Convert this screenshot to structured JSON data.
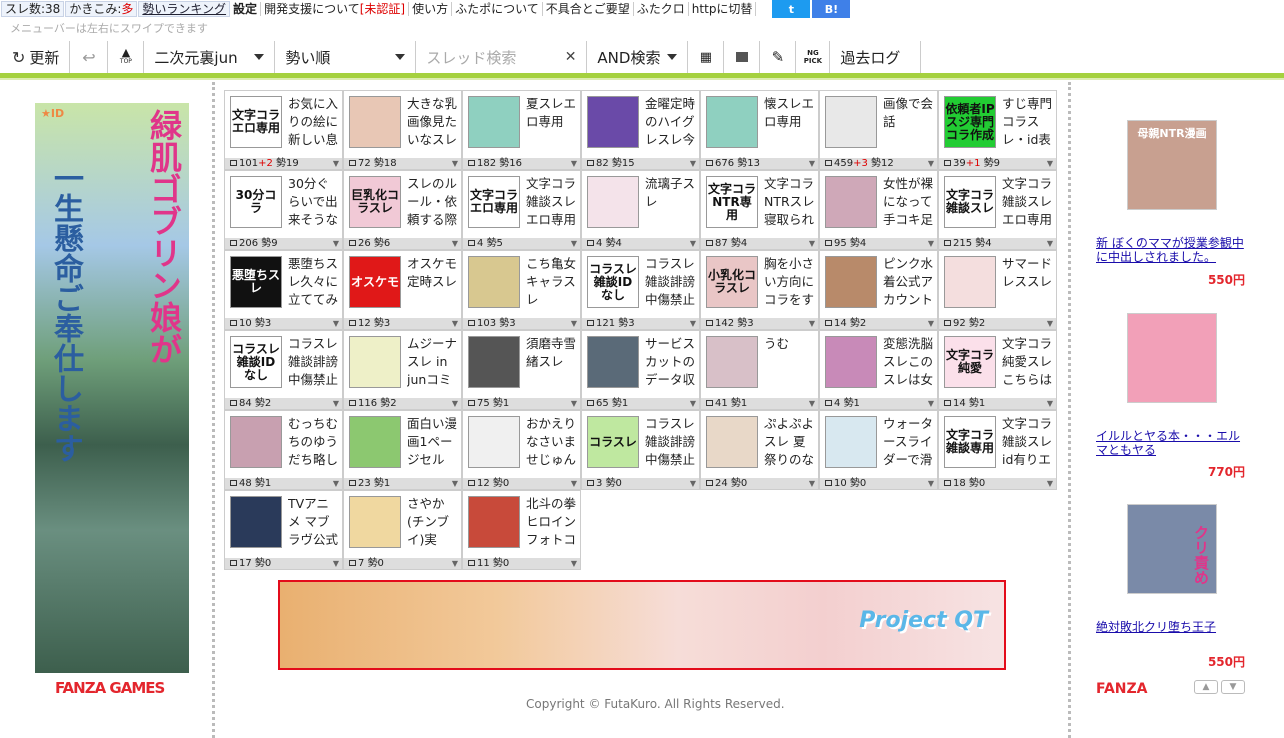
{
  "topmenu": {
    "thread_count": "スレ数:38",
    "posts_label": "かきこみ:",
    "posts_value": "多",
    "ranking": "勢いランキング",
    "settings": "設定",
    "devsupport": "開発支援について",
    "unverified": "[未認証]",
    "howto": "使い方",
    "about": "ふたポについて",
    "bugs": "不具合とご要望",
    "futakuro": "ふたクロ",
    "http": "httpに切替",
    "twitter": "t",
    "hatena": "B!"
  },
  "hint": "メニューバーは左右にスワイプできます",
  "toolbar": {
    "refresh": "更新",
    "top": "TOP",
    "board": "二次元裏jun",
    "sort": "勢い順",
    "search_placeholder": "スレッド検索",
    "search_mode": "AND検索",
    "ng": "NG PICK",
    "past_log": "過去ログ"
  },
  "colors": {
    "accent_green": "#a5d13e",
    "red": "#e3262d"
  },
  "left_ad": {
    "brand": "FANZA GAMES",
    "text1": "緑肌ゴブリン娘が",
    "text2": "一生懸命ご奉仕します"
  },
  "threads": [
    {
      "title": "お気に入りの絵に新しい息",
      "count": "101",
      "plus": "+2",
      "ikioi": "勢19",
      "thumb": "文字コラエロ専用",
      "bg": "#ffffff"
    },
    {
      "title": "大きな乳画像見たいなスレ",
      "count": "72",
      "plus": "",
      "ikioi": "勢18",
      "thumb": "",
      "bg": "#e8c7b5"
    },
    {
      "title": "夏スレエロ専用",
      "count": "182",
      "plus": "",
      "ikioi": "勢16",
      "thumb": "",
      "bg": "#8fd0c0"
    },
    {
      "title": "金曜定時のハイグレスレ今",
      "count": "82",
      "plus": "",
      "ikioi": "勢15",
      "thumb": "",
      "bg": "#6a4aa8"
    },
    {
      "title": "懐スレエロ専用",
      "count": "676",
      "plus": "",
      "ikioi": "勢13",
      "thumb": "",
      "bg": "#8fd0c0"
    },
    {
      "title": "画像で会話",
      "count": "459",
      "plus": "+3",
      "ikioi": "勢12",
      "thumb": "",
      "bg": "#e8e8e8"
    },
    {
      "title": "すじ専門コラスレ・id表",
      "count": "39",
      "plus": "+1",
      "ikioi": "勢9",
      "thumb": "依頼者IPスジ専門コラ作成",
      "bg": "#22cc33"
    },
    {
      "title": "30分ぐらいで出来そうなコ",
      "count": "206",
      "plus": "",
      "ikioi": "勢9",
      "thumb": "30分コラ",
      "bg": "#ffffff"
    },
    {
      "title": "スレのルール・依頼する際",
      "count": "26",
      "plus": "",
      "ikioi": "勢6",
      "thumb": "巨乳化コラスレ",
      "bg": "#f1c9d6"
    },
    {
      "title": "文字コラ雑談スレエロ専用",
      "count": "4",
      "plus": "",
      "ikioi": "勢5",
      "thumb": "文字コラエロ専用",
      "bg": "#ffffff"
    },
    {
      "title": "流璃子スレ",
      "count": "4",
      "plus": "",
      "ikioi": "勢4",
      "thumb": "",
      "bg": "#f4e3ea"
    },
    {
      "title": "文字コラNTRスレ寝取られ",
      "count": "87",
      "plus": "",
      "ikioi": "勢4",
      "thumb": "文字コラNTR専用",
      "bg": "#ffffff"
    },
    {
      "title": "女性が裸になって手コキ足",
      "count": "95",
      "plus": "",
      "ikioi": "勢4",
      "thumb": "",
      "bg": "#cfa8b8"
    },
    {
      "title": "文字コラ雑談スレエロ専用",
      "count": "215",
      "plus": "",
      "ikioi": "勢4",
      "thumb": "文字コラ雑談スレ",
      "bg": "#ffffff"
    },
    {
      "title": "悪堕ちスレ久々に立ててみ",
      "count": "10",
      "plus": "",
      "ikioi": "勢3",
      "thumb": "悪堕ちスレ",
      "bg": "#111111"
    },
    {
      "title": "オスケモ定時スレ",
      "count": "12",
      "plus": "",
      "ikioi": "勢3",
      "thumb": "オスケモ",
      "bg": "#e01818"
    },
    {
      "title": "こち亀女キャラスレ",
      "count": "103",
      "plus": "",
      "ikioi": "勢3",
      "thumb": "",
      "bg": "#d8c890"
    },
    {
      "title": "コラスレ雑談誹謗中傷禁止",
      "count": "121",
      "plus": "",
      "ikioi": "勢3",
      "thumb": "コラスレ雑談IDなし",
      "bg": "#ffffff"
    },
    {
      "title": "胸を小さい方向にコラをす",
      "count": "142",
      "plus": "",
      "ikioi": "勢3",
      "thumb": "小乳化コラスレ",
      "bg": "#e9c6c6"
    },
    {
      "title": "ピンク水着公式アカウント",
      "count": "14",
      "plus": "",
      "ikioi": "勢2",
      "thumb": "",
      "bg": "#b88a6a"
    },
    {
      "title": "サマードレススレ",
      "count": "92",
      "plus": "",
      "ikioi": "勢2",
      "thumb": "",
      "bg": "#f4dede"
    },
    {
      "title": "コラスレ雑談誹謗中傷禁止",
      "count": "84",
      "plus": "",
      "ikioi": "勢2",
      "thumb": "コラスレ雑談IDなし",
      "bg": "#ffffff"
    },
    {
      "title": "ムジーナスレ in junコミ",
      "count": "116",
      "plus": "",
      "ikioi": "勢2",
      "thumb": "",
      "bg": "#eef0c8"
    },
    {
      "title": "須磨寺雪緒スレ",
      "count": "75",
      "plus": "",
      "ikioi": "勢1",
      "thumb": "",
      "bg": "#555555"
    },
    {
      "title": "サービスカットのデータ収",
      "count": "65",
      "plus": "",
      "ikioi": "勢1",
      "thumb": "",
      "bg": "#5a6a78"
    },
    {
      "title": "うむ",
      "count": "41",
      "plus": "",
      "ikioi": "勢1",
      "thumb": "",
      "bg": "#d8c0c8"
    },
    {
      "title": "変態洗脳スレこのスレは女",
      "count": "4",
      "plus": "",
      "ikioi": "勢1",
      "thumb": "",
      "bg": "#c88ab8"
    },
    {
      "title": "文字コラ純愛スレこちらは",
      "count": "14",
      "plus": "",
      "ikioi": "勢1",
      "thumb": "文字コラ純愛",
      "bg": "#fbe0ea"
    },
    {
      "title": "むっちむちのゆうだち略し",
      "count": "48",
      "plus": "",
      "ikioi": "勢1",
      "thumb": "",
      "bg": "#c8a0b0"
    },
    {
      "title": "面白い漫画1ページセルク、",
      "count": "23",
      "plus": "",
      "ikioi": "勢1",
      "thumb": "",
      "bg": "#8cc870"
    },
    {
      "title": "おかえりなさいませじゅん",
      "count": "12",
      "plus": "",
      "ikioi": "勢0",
      "thumb": "",
      "bg": "#f0f0f0"
    },
    {
      "title": "コラスレ雑談誹謗中傷禁止",
      "count": "3",
      "plus": "",
      "ikioi": "勢0",
      "thumb": "コラスレ",
      "bg": "#bfe8a0"
    },
    {
      "title": "ぷよぷよスレ 夏祭りのな",
      "count": "24",
      "plus": "",
      "ikioi": "勢0",
      "thumb": "",
      "bg": "#e8d8c8"
    },
    {
      "title": "ウォータースライダーで滑",
      "count": "10",
      "plus": "",
      "ikioi": "勢0",
      "thumb": "",
      "bg": "#d8e8f0"
    },
    {
      "title": "文字コラ雑談スレid有りエ",
      "count": "18",
      "plus": "",
      "ikioi": "勢0",
      "thumb": "文字コラ雑談専用",
      "bg": "#ffffff"
    },
    {
      "title": "TVアニメ マブラヴ公式",
      "count": "17",
      "plus": "",
      "ikioi": "勢0",
      "thumb": "",
      "bg": "#2a3a5a"
    },
    {
      "title": "さやか(チンブイ)実",
      "count": "7",
      "plus": "",
      "ikioi": "勢0",
      "thumb": "",
      "bg": "#f0d8a0"
    },
    {
      "title": "北斗の拳ヒロインフォトコ",
      "count": "11",
      "plus": "",
      "ikioi": "勢0",
      "thumb": "",
      "bg": "#c84a3a"
    }
  ],
  "banner": {
    "text": "Project QT"
  },
  "copyright": "Copyright © FutaKuro. All Rights Reserved.",
  "right_ads": [
    {
      "title": "新 ぼくのママが授業参観中に中出しされました。",
      "price": "550円",
      "img": "母親NTR漫画",
      "bg": "#c8a090"
    },
    {
      "title": "イルルとヤる本・・・エルマともヤる",
      "price": "770円",
      "img": "",
      "bg": "#f2a0b8"
    },
    {
      "title": "絶対敗北クリ堕ち王子",
      "price": "550円",
      "img": "クリ責め",
      "bg": "#7a8aa8"
    }
  ],
  "fanza": "FANZA",
  "scroll_up": "▲",
  "scroll_down": "▼"
}
